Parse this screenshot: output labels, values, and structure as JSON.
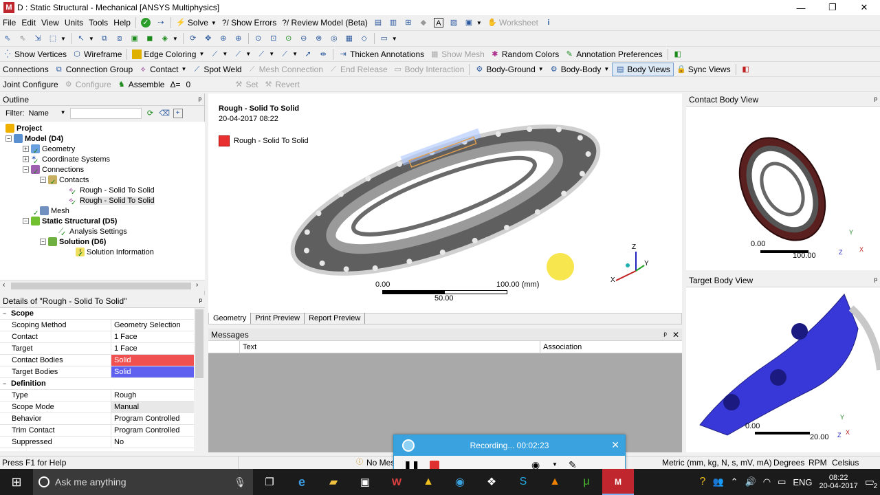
{
  "window": {
    "title": "D : Static Structural - Mechanical [ANSYS Multiphysics]",
    "logo": "M",
    "minimize": "—",
    "maximize": "❐",
    "close": "✕"
  },
  "menu": [
    "File",
    "Edit",
    "View",
    "Units",
    "Tools",
    "Help"
  ],
  "toolbar1": {
    "solve": "Solve",
    "show_errors": "?/ Show Errors",
    "review_model": "?/ Review Model (Beta)",
    "worksheet": "Worksheet"
  },
  "toolbar3": {
    "show_vertices": "Show Vertices",
    "wireframe": "Wireframe",
    "edge_coloring": "Edge Coloring",
    "thicken_annotations": "Thicken Annotations",
    "show_mesh": "Show Mesh",
    "random_colors": "Random Colors",
    "annotation_preferences": "Annotation Preferences"
  },
  "toolbar4": {
    "connections": "Connections",
    "connection_group": "Connection Group",
    "contact": "Contact",
    "spot_weld": "Spot Weld",
    "mesh_connection": "Mesh Connection",
    "end_release": "End Release",
    "body_interaction": "Body Interaction",
    "body_ground": "Body-Ground",
    "body_body": "Body-Body",
    "body_views": "Body Views",
    "sync_views": "Sync Views"
  },
  "toolbar5": {
    "joint_configure": "Joint Configure",
    "configure": "Configure",
    "assemble": "Assemble",
    "delta_label": "Δ=",
    "delta_value": "0",
    "set": "Set",
    "revert": "Revert"
  },
  "outline": {
    "title": "Outline",
    "pin": "ᵖ",
    "filter_label": "Filter:",
    "filter_value": "Name",
    "tree": [
      {
        "label": "Project"
      },
      {
        "label": "Model (D4)"
      },
      {
        "label": "Geometry"
      },
      {
        "label": "Coordinate Systems"
      },
      {
        "label": "Connections"
      },
      {
        "label": "Contacts"
      },
      {
        "label": "Rough - Solid To Solid"
      },
      {
        "label": "Rough - Solid To Solid"
      },
      {
        "label": "Mesh"
      },
      {
        "label": "Static Structural (D5)"
      },
      {
        "label": "Analysis Settings"
      },
      {
        "label": "Solution (D6)"
      },
      {
        "label": "Solution Information"
      }
    ]
  },
  "details": {
    "title": "Details of \"Rough - Solid To Solid\"",
    "rows": [
      {
        "k": "Scope",
        "v": ""
      },
      {
        "k": "Scoping Method",
        "v": "Geometry Selection"
      },
      {
        "k": "Contact",
        "v": "1 Face"
      },
      {
        "k": "Target",
        "v": "1 Face"
      },
      {
        "k": "Contact Bodies",
        "v": "Solid"
      },
      {
        "k": "Target Bodies",
        "v": "Solid"
      },
      {
        "k": "Definition",
        "v": ""
      },
      {
        "k": "Type",
        "v": "Rough"
      },
      {
        "k": "Scope Mode",
        "v": "Manual"
      },
      {
        "k": "Behavior",
        "v": "Program Controlled"
      },
      {
        "k": "Trim Contact",
        "v": "Program Controlled"
      },
      {
        "k": "Suppressed",
        "v": "No"
      }
    ],
    "colors": {
      "contact": "#f05050",
      "target": "#6060f0"
    }
  },
  "viewport": {
    "heading": "Rough - Solid To Solid",
    "date": "20-04-2017 08:22",
    "legend": "Rough - Solid To Solid",
    "legend_color": "#e83030",
    "scale_min": "0.00",
    "scale_mid": "50.00",
    "scale_max": "100.00 (mm)",
    "axis_z": "Z",
    "axis_y": "Y",
    "axis_x": "X",
    "tabs": [
      "Geometry",
      "Print Preview",
      "Report Preview"
    ]
  },
  "messages": {
    "title": "Messages",
    "col_text": "Text",
    "col_association": "Association"
  },
  "contact_body_view": {
    "title": "Contact Body View",
    "scale_min": "0.00",
    "scale_max": "100.00",
    "axis_y": "Y",
    "axis_x": "X",
    "axis_z": "Z"
  },
  "target_body_view": {
    "title": "Target Body View",
    "scale_min": "0.00",
    "scale_max": "20.00",
    "axis_y": "Y",
    "axis_x": "X",
    "axis_z": "Z"
  },
  "status": {
    "help": "Press F1 for Help",
    "messages": "No Mes",
    "units": "Metric (mm, kg, N, s, mV, mA)",
    "angle": "Degrees",
    "rpm": "RPM",
    "temp": "Celsius"
  },
  "recording": {
    "label": "Recording... 00:02:23"
  },
  "taskbar": {
    "search": "Ask me anything",
    "lang": "ENG",
    "time": "08:22",
    "date": "20-04-2017",
    "notif": "2"
  }
}
